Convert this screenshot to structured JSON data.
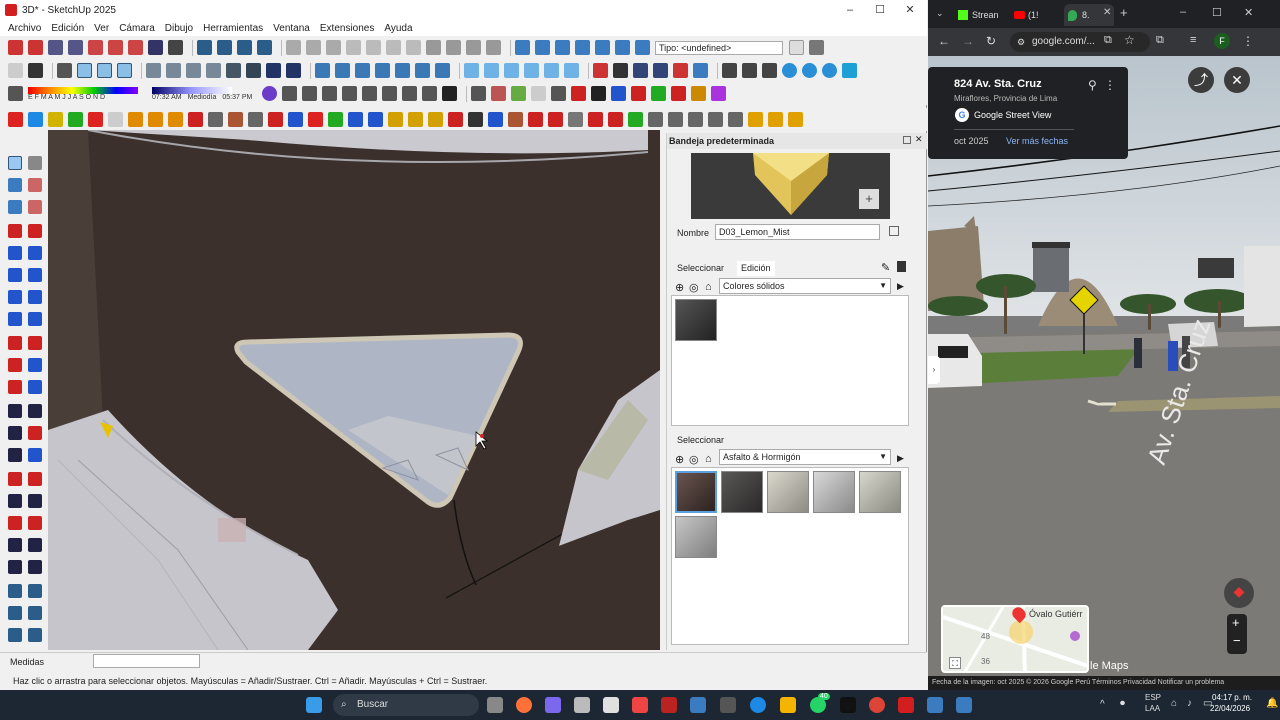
{
  "sketchup": {
    "window_title": "3D* - SketchUp 2025",
    "window_controls": [
      "–",
      "☐",
      "✕"
    ],
    "menu": [
      "Archivo",
      "Edición",
      "Ver",
      "Cámara",
      "Dibujo",
      "Herramientas",
      "Ventana",
      "Extensiones",
      "Ayuda"
    ],
    "tipo_field": "Tipo: <undefined>",
    "shadow_time_start": "07:32 AM",
    "shadow_time_mid": "Mediodía",
    "shadow_time_end": "05:37 PM",
    "months": "E F M A M J J A S O N D",
    "tray": {
      "title": "Bandeja predeterminada",
      "name_label": "Nombre",
      "name_value": "D03_Lemon_Mist",
      "tab_select": "Seleccionar",
      "tab_edit": "Edición",
      "library_1": "Colores sólidos",
      "select_label_2": "Seleccionar",
      "library_2": "Asfalto & Hormigón"
    },
    "status": {
      "measure_label": "Medidas",
      "hint": "Haz clic o arrastra para seleccionar objetos. Mayúsculas = Añadir/Sustraer. Ctrl = Añadir. Mayúsculas + Ctrl = Sustraer."
    },
    "colors": {
      "viewport_floor": "#3b302b",
      "triangle": "#aab3c3",
      "paving": "#c7c7cc"
    }
  },
  "chrome": {
    "tabs": [
      "Strean",
      "(1!",
      "8."
    ],
    "url": "google.com/...",
    "avatar_letter": "F",
    "streetview": {
      "address": "824 Av. Sta. Cruz",
      "locality": "Miraflores, Provincia de Lima",
      "service": "Google Street View",
      "date": "oct 2025",
      "more_dates": "Ver más fechas",
      "street_label": "Av. Sta. Cruz",
      "map_label": "Óvalo Gutiérr",
      "map_num_1": "48",
      "map_num_2": "36",
      "maps_brand": "le Maps",
      "footer": "Fecha de la imagen: oct 2025   © 2026 Google   Perú   Términos   Privacidad   Notificar un problema"
    }
  },
  "taskbar": {
    "search_placeholder": "Buscar",
    "lang": "ESP",
    "lang2": "LAA",
    "time": "04:17 p. m.",
    "date": "22/04/2026",
    "badge": "40"
  }
}
